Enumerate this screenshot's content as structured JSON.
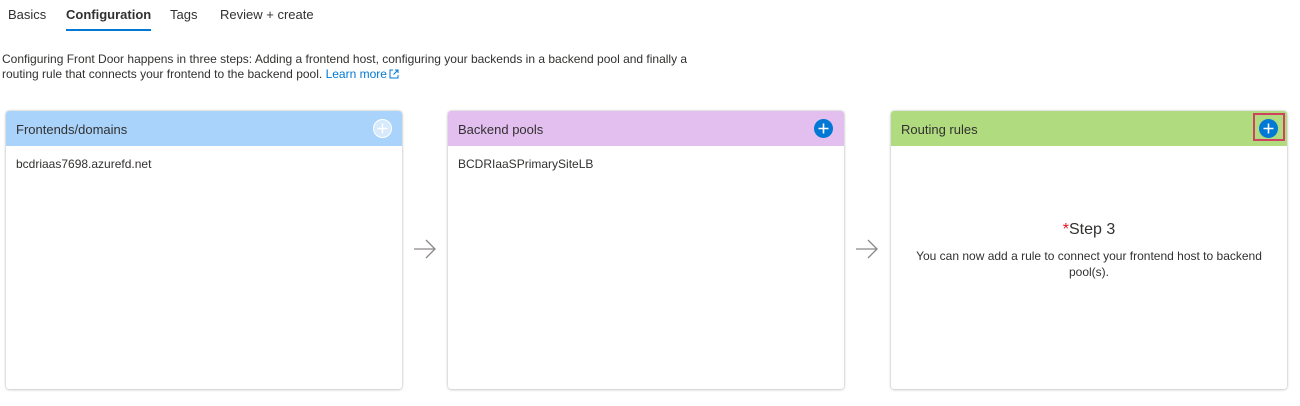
{
  "tabs": [
    {
      "label": "Basics",
      "active": false
    },
    {
      "label": "Configuration",
      "active": true
    },
    {
      "label": "Tags",
      "active": false
    },
    {
      "label": "Review + create",
      "active": false
    }
  ],
  "description": {
    "text": "Configuring Front Door happens in three steps: Adding a frontend host, configuring your backends in a backend pool and finally a routing rule that connects your frontend to the backend pool.",
    "link_label": "Learn more"
  },
  "cards": {
    "frontends": {
      "title": "Frontends/domains",
      "header_color": "#a9d3fa",
      "items": [
        "bcdriaas7698.azurefd.net"
      ],
      "add_icon": "plus-circle-icon"
    },
    "backends": {
      "title": "Backend pools",
      "header_color": "#e3bff0",
      "items": [
        "BCDRIaaSPrimarySiteLB"
      ],
      "add_icon": "plus-circle-icon"
    },
    "routing": {
      "title": "Routing rules",
      "header_color": "#b0dc7f",
      "add_icon": "plus-circle-icon",
      "step_required_mark": "*",
      "step_title": "Step 3",
      "step_text": "You can now add a rule to connect your frontend host to backend pool(s)."
    }
  },
  "colors": {
    "accent": "#0078d4",
    "highlight": "#d0435f"
  }
}
